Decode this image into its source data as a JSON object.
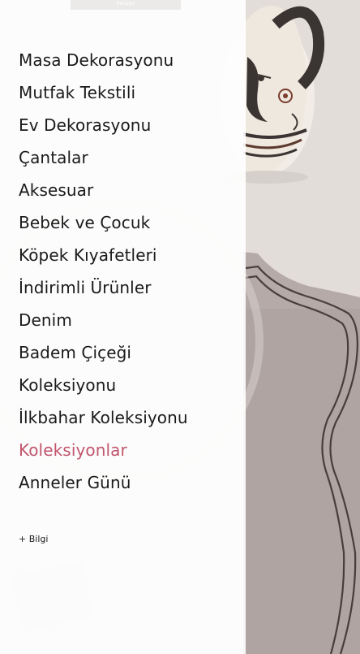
{
  "top_tab": {
    "label": "İletişim"
  },
  "menu": {
    "items": [
      {
        "label": "Masa Dekorasyonu",
        "active": false
      },
      {
        "label": "Mutfak Tekstili",
        "active": false
      },
      {
        "label": "Ev Dekorasyonu",
        "active": false
      },
      {
        "label": "Çantalar",
        "active": false
      },
      {
        "label": "Aksesuar",
        "active": false
      },
      {
        "label": "Bebek ve Çocuk",
        "active": false
      },
      {
        "label": "Köpek Kıyafetleri",
        "active": false
      },
      {
        "label": "İndirimli Ürünler",
        "active": false
      },
      {
        "label": "Denim",
        "active": false
      },
      {
        "label": "Badem Çiçeği",
        "active": false
      },
      {
        "label": "Koleksiyonu",
        "active": false
      },
      {
        "label": "İlkbahar Koleksiyonu",
        "active": false
      },
      {
        "label": "Koleksiyonlar",
        "active": true
      },
      {
        "label": "Anneler Günü",
        "active": false
      }
    ]
  },
  "footer": {
    "info_label": "+ Bilgi"
  },
  "colors": {
    "text": "#1a1a1a",
    "active": "#c0566d",
    "panel": "#ffffff",
    "napkin": "#b6aaa8",
    "stitch": "#4a3f3d"
  }
}
